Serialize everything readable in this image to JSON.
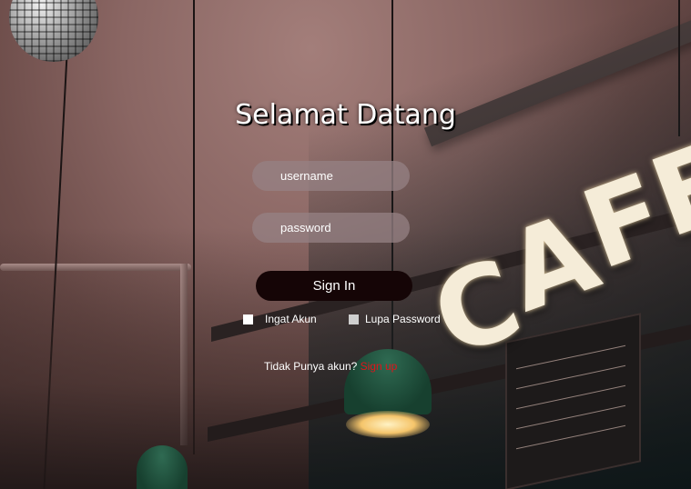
{
  "login": {
    "title": "Selamat Datang",
    "username_placeholder": "username",
    "username_value": "",
    "password_placeholder": "password",
    "password_value": "",
    "signin_label": "Sign In",
    "remember_label": "Ingat Akun",
    "forgot_label": "Lupa Password",
    "no_account_text": "Tidak Punya akun?",
    "signup_label": "Sign up"
  },
  "background": {
    "sign_letters": [
      "C",
      "A",
      "F",
      "E"
    ]
  },
  "colors": {
    "signin_button": "#150506",
    "signup_link": "#e1141a",
    "field_fill": "#96828499"
  }
}
